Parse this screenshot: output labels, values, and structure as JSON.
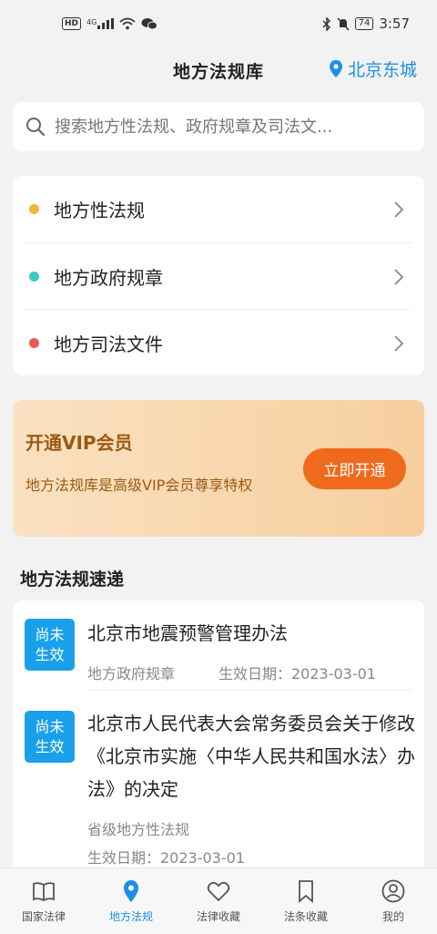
{
  "status_bar": {
    "hd": "HD",
    "signal": "4G",
    "battery": "74",
    "time": "3:57"
  },
  "header": {
    "title": "地方法规库",
    "location": "北京东城"
  },
  "search": {
    "placeholder": "搜索地方性法规、政府规章及司法文..."
  },
  "categories": [
    {
      "label": "地方性法规",
      "dot_color": "#f4b23e"
    },
    {
      "label": "地方政府规章",
      "dot_color": "#3cc8c8"
    },
    {
      "label": "地方司法文件",
      "dot_color": "#e85a4f"
    }
  ],
  "vip": {
    "title": "开通VIP会员",
    "description": "地方法规库是高级VIP会员尊享特权",
    "button": "立即开通"
  },
  "section": {
    "title": "地方法规速递"
  },
  "news": [
    {
      "badge_line1": "尚未",
      "badge_line2": "生效",
      "title": "北京市地震预警管理办法",
      "category": "地方政府规章",
      "effective": "生效日期：2023-03-01"
    },
    {
      "badge_line1": "尚未",
      "badge_line2": "生效",
      "title": "北京市人民代表大会常务委员会关于修改《北京市实施〈中华人民共和国水法〉办法》的决定",
      "category": "省级地方性法规",
      "effective": "生效日期：2023-03-01"
    }
  ],
  "nav": [
    {
      "label": "国家法律",
      "icon": "book-icon"
    },
    {
      "label": "地方法规",
      "icon": "location-pin-icon"
    },
    {
      "label": "法律收藏",
      "icon": "heart-icon"
    },
    {
      "label": "法条收藏",
      "icon": "bookmark-icon"
    },
    {
      "label": "我的",
      "icon": "user-icon"
    }
  ],
  "colors": {
    "accent": "#1e8fe1",
    "badge": "#1aa0ea",
    "vip_button": "#f06a1d",
    "vip_text": "#9a5a12"
  }
}
